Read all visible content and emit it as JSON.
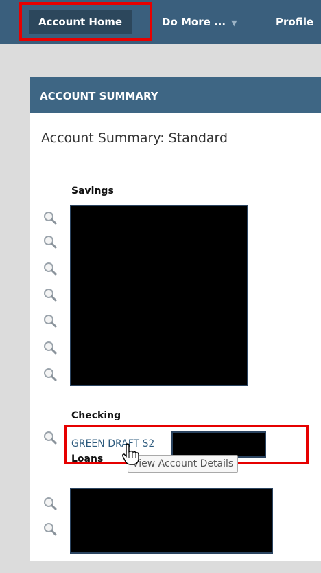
{
  "nav": {
    "home": "Account Home",
    "do_more": "Do More ...",
    "profile": "Profile"
  },
  "panel": {
    "header": "ACCOUNT SUMMARY",
    "title": "Account Summary: Standard"
  },
  "sections": {
    "savings": "Savings",
    "checking": "Checking",
    "loans": "Loans"
  },
  "checking_account": {
    "name": "GREEN DRAFT S2"
  },
  "tooltip": "View Account Details",
  "icons": {
    "lookup": "magnifier-icon",
    "caret": "chevron-down-icon",
    "cursor": "hand-pointer-icon"
  },
  "colors": {
    "nav": "#3a5f7d",
    "panel_header": "#3e6684",
    "highlight": "#e60000"
  }
}
